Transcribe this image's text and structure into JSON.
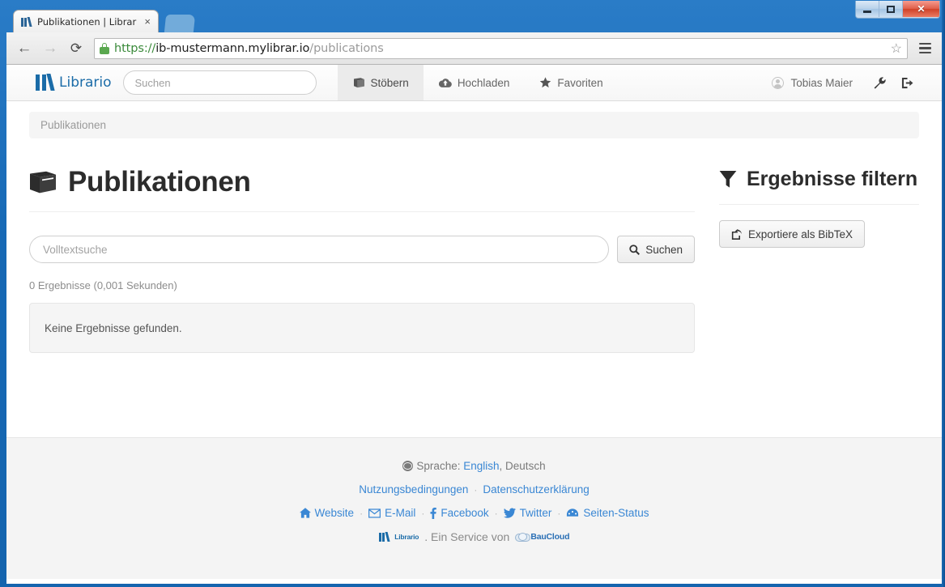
{
  "browser": {
    "tab_title": "Publikationen | Librario",
    "tab_close": "×",
    "back_icon": "←",
    "forward_icon": "→",
    "reload_icon": "⟳",
    "url_scheme": "https://",
    "url_host": "ib-mustermann.mylibrar.io",
    "url_path": "/publications",
    "star_icon": "☆",
    "minimize_label": "–",
    "maximize_label": "□",
    "close_label": "✕"
  },
  "navbar": {
    "brand": "Librario",
    "search_placeholder": "Suchen",
    "search_value": "",
    "items": [
      {
        "label": "Stöbern",
        "icon": "📕",
        "active": true
      },
      {
        "label": "Hochladen",
        "icon": "☁",
        "active": false
      },
      {
        "label": "Favoriten",
        "icon": "★",
        "active": false
      }
    ],
    "user": "Tobias Maier",
    "settings_icon": "🔧",
    "logout_icon": "⇥"
  },
  "breadcrumb": {
    "current": "Publikationen"
  },
  "main": {
    "title": "Publikationen",
    "title_icon": "📕",
    "fulltext_placeholder": "Volltextsuche",
    "fulltext_value": "",
    "search_button": "Suchen",
    "search_icon": "🔍",
    "result_count": "0 Ergebnisse (0,001 Sekunden)",
    "empty_message": "Keine Ergebnisse gefunden."
  },
  "sidebar": {
    "title": "Ergebnisse filtern",
    "export_button": "Exportiere als BibTeX"
  },
  "footer": {
    "language_label": "Sprache:",
    "languages": [
      {
        "label": "English",
        "link": true
      },
      {
        "label": "Deutsch",
        "link": false
      }
    ],
    "language_separator": ",",
    "legal": [
      {
        "label": "Nutzungsbedingungen"
      },
      {
        "label": "Datenschutzerklärung"
      }
    ],
    "legal_separator": "·",
    "links": [
      {
        "label": "Website",
        "icon": "home-icon"
      },
      {
        "label": "E-Mail",
        "icon": "envelope-icon"
      },
      {
        "label": "Facebook",
        "icon": "facebook-icon"
      },
      {
        "label": "Twitter",
        "icon": "twitter-icon"
      },
      {
        "label": "Seiten-Status",
        "icon": "dashboard-icon"
      }
    ],
    "link_separator": "·",
    "service_brand": "Librario",
    "service_text": ". Ein Service von",
    "service_provider": "BauCloud"
  },
  "colors": {
    "accent": "#1b6ca8",
    "link": "#3a87d4",
    "window_chrome": "#1769b5",
    "footer_bg": "#f4f4f4"
  }
}
